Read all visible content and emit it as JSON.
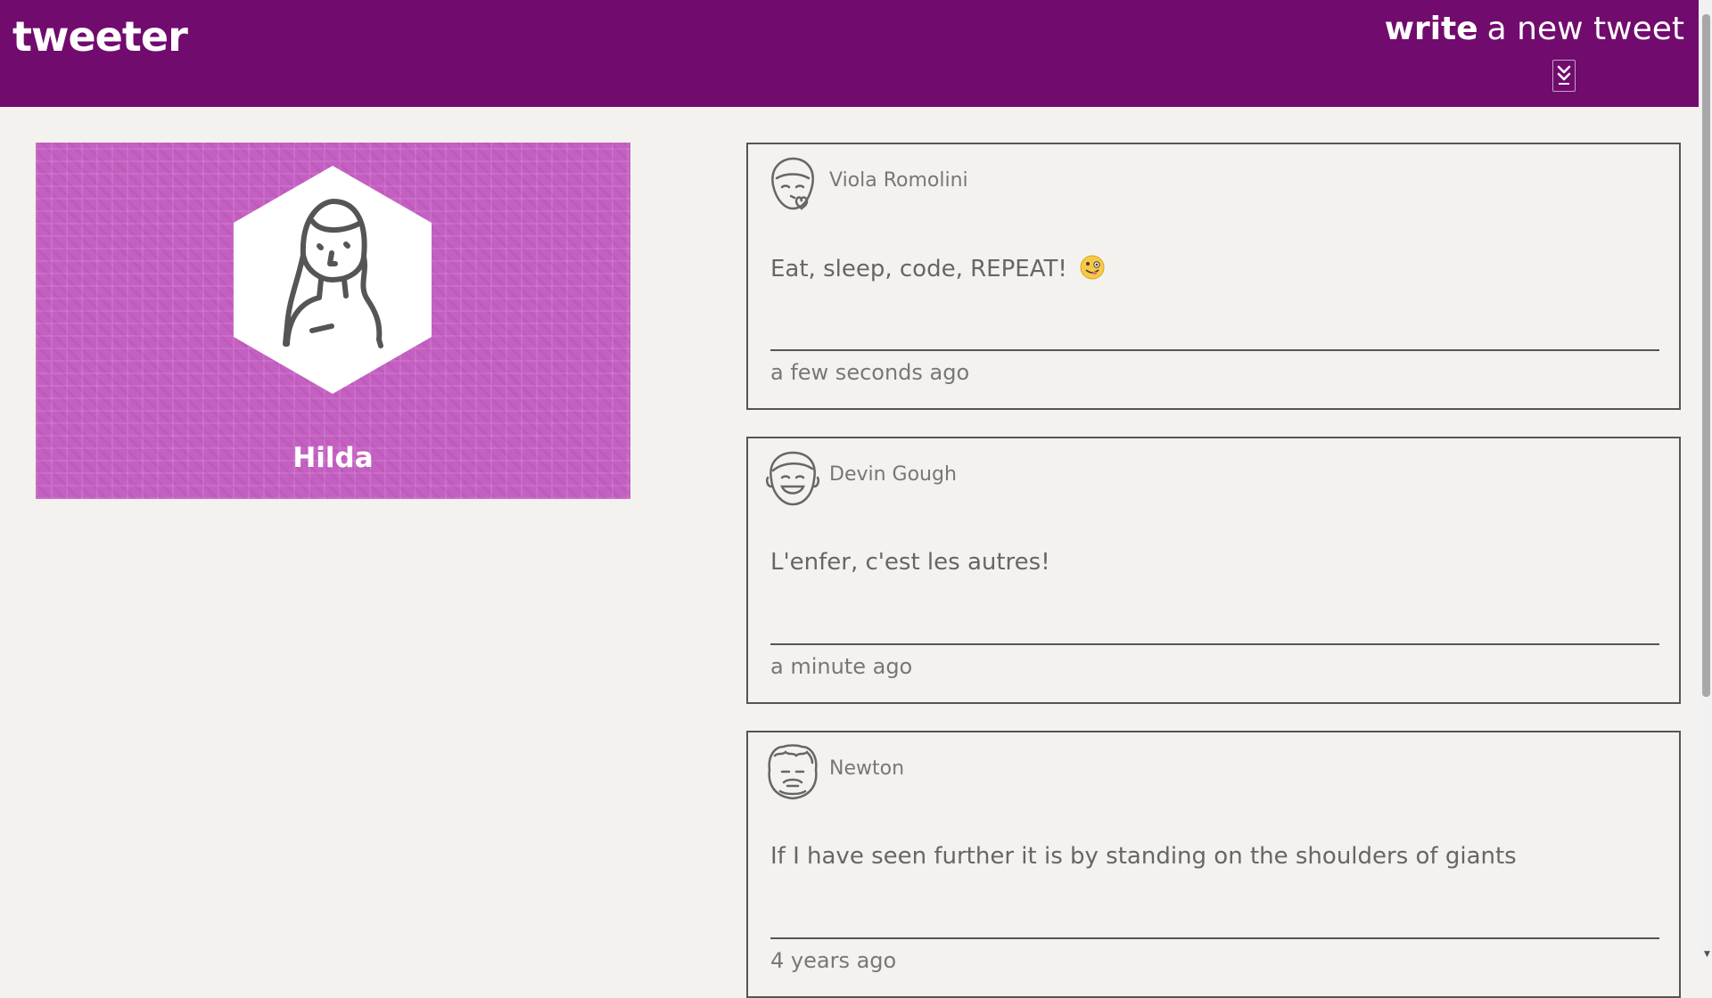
{
  "header": {
    "brand": "tweeter",
    "compose_word1": "write",
    "compose_word2": "a new tweet"
  },
  "profile": {
    "name": "Hilda",
    "background_color": "#c560c3"
  },
  "tweets": [
    {
      "author": "Viola Romolini",
      "content": "Eat, sleep, code, REPEAT!",
      "emoji": "crazy-face-emoji",
      "time": "a few seconds ago"
    },
    {
      "author": "Devin Gough",
      "content": "L'enfer, c'est les autres!",
      "time": "a minute ago"
    },
    {
      "author": "Newton",
      "content": "If I have seen further it is by standing on the shoulders of giants",
      "time": "4 years ago"
    }
  ],
  "colors": {
    "header_bg": "#720b6e",
    "page_bg": "#f4f2ee",
    "card_border": "#555555"
  }
}
